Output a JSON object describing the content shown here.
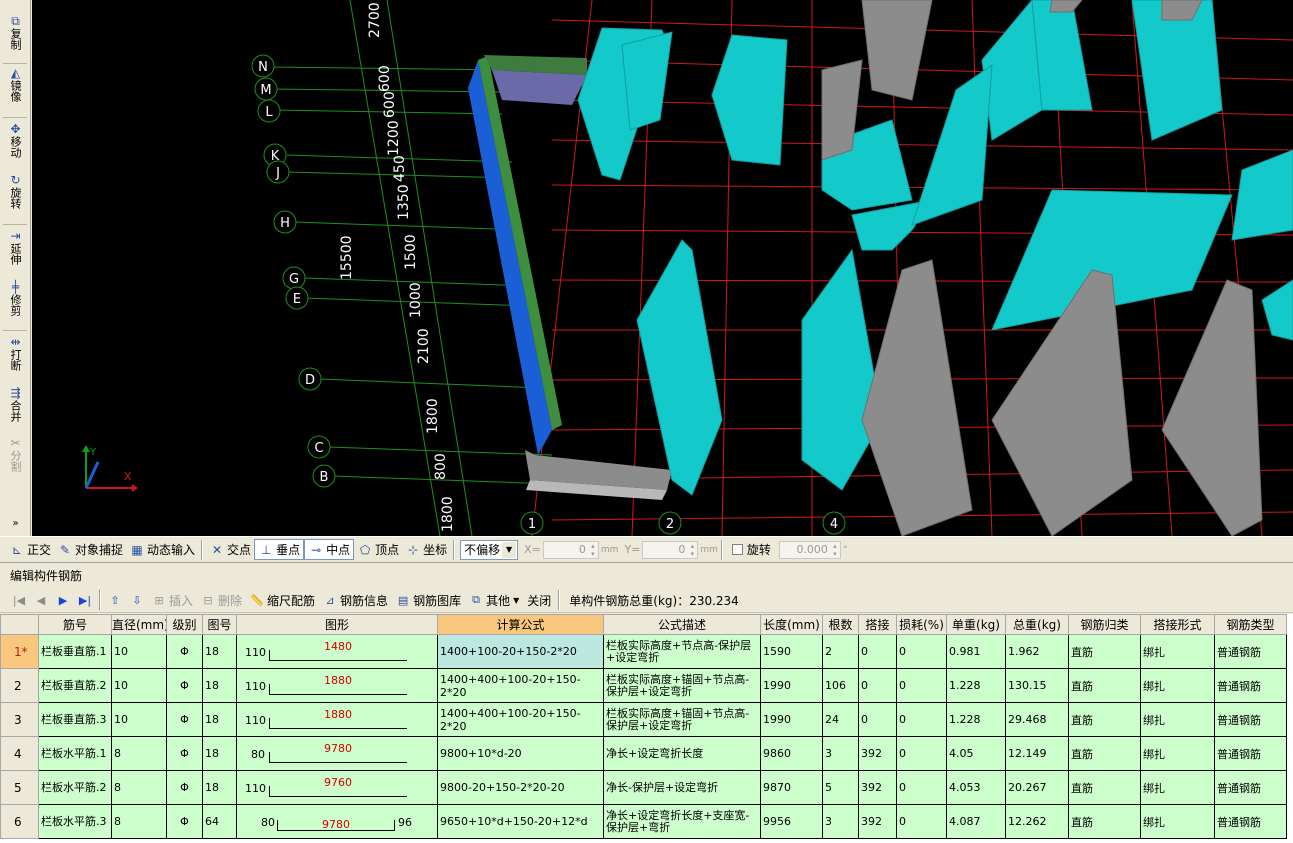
{
  "left_toolbar": {
    "tools": [
      {
        "label": "复制",
        "icon": "copy-icon",
        "glyph": "⧉",
        "disabled": false
      },
      {
        "label": "镜像",
        "icon": "mirror-icon",
        "glyph": "◭",
        "disabled": false
      },
      {
        "label": "移动",
        "icon": "move-icon",
        "glyph": "✥",
        "disabled": false
      },
      {
        "label": "旋转",
        "icon": "rotate-icon",
        "glyph": "↻",
        "disabled": false
      },
      {
        "label": "延伸",
        "icon": "extend-icon",
        "glyph": "⇥",
        "disabled": false
      },
      {
        "label": "修剪",
        "icon": "trim-icon",
        "glyph": "╪",
        "disabled": false
      },
      {
        "label": "打断",
        "icon": "break-icon",
        "glyph": "⇹",
        "disabled": false
      },
      {
        "label": "合并",
        "icon": "merge-icon",
        "glyph": "⇶",
        "disabled": false
      },
      {
        "label": "分割",
        "icon": "split-icon",
        "glyph": "✂",
        "disabled": true
      }
    ]
  },
  "canvas": {
    "axis_labels": [
      "N",
      "M",
      "L",
      "K",
      "J",
      "H",
      "G",
      "E",
      "D",
      "C",
      "B"
    ],
    "dimension_labels": [
      "2700",
      "600",
      "600",
      "1200",
      "450",
      "1350",
      "1500",
      "15500",
      "1000",
      "2100",
      "1800",
      "800",
      "1800"
    ],
    "bottom_axis_labels": [
      "1",
      "2",
      "4"
    ],
    "ucs": {
      "x": "X",
      "y": "Y"
    }
  },
  "snap_bar": {
    "ortho": "正交",
    "object_snap": "对象捕捉",
    "dynamic_input": "动态输入",
    "intersection": "交点",
    "perpendicular": "垂点",
    "midpoint": "中点",
    "vertex": "顶点",
    "coordinate": "坐标",
    "offset_mode": "不偏移",
    "x_label": "X=",
    "x_value": "0",
    "y_label": "Y=",
    "y_value": "0",
    "unit": "mm",
    "rotate_label": "旋转",
    "rotate_value": "0.000",
    "degree": "°"
  },
  "editor": {
    "title": "编辑构件钢筋",
    "toolbar": {
      "insert": "插入",
      "delete": "删除",
      "scale_rebar": "缩尺配筋",
      "rebar_info": "钢筋信息",
      "rebar_library": "钢筋图库",
      "other": "其他",
      "close": "关闭",
      "total_weight_label": "单构件钢筋总重(kg)：230.234"
    }
  },
  "table": {
    "columns": [
      "",
      "筋号",
      "直径(mm)",
      "级别",
      "图号",
      "图形",
      "计算公式",
      "公式描述",
      "长度(mm)",
      "根数",
      "搭接",
      "损耗(%)",
      "单重(kg)",
      "总重(kg)",
      "钢筋归类",
      "搭接形式",
      "钢筋类型"
    ],
    "rows": [
      {
        "num": "1*",
        "name": "栏板垂直筋.1",
        "dia": "10",
        "grade": "Φ",
        "fig": "18",
        "shape_lead": "110",
        "shape_len": "1480",
        "shape_tail": "",
        "formula": "1400+100-20+150-2*20",
        "desc": "栏板实际高度+节点高-保护层+设定弯折",
        "length": "1590",
        "count": "2",
        "lap": "0",
        "loss": "0",
        "unit_w": "0.981",
        "total_w": "1.962",
        "category": "直筋",
        "lap_type": "绑扎",
        "type": "普通钢筋"
      },
      {
        "num": "2",
        "name": "栏板垂直筋.2",
        "dia": "10",
        "grade": "Φ",
        "fig": "18",
        "shape_lead": "110",
        "shape_len": "1880",
        "shape_tail": "",
        "formula": "1400+400+100-20+150-2*20",
        "desc": "栏板实际高度+锚固+节点高-保护层+设定弯折",
        "length": "1990",
        "count": "106",
        "lap": "0",
        "loss": "0",
        "unit_w": "1.228",
        "total_w": "130.15",
        "category": "直筋",
        "lap_type": "绑扎",
        "type": "普通钢筋"
      },
      {
        "num": "3",
        "name": "栏板垂直筋.3",
        "dia": "10",
        "grade": "Φ",
        "fig": "18",
        "shape_lead": "110",
        "shape_len": "1880",
        "shape_tail": "",
        "formula": "1400+400+100-20+150-2*20",
        "desc": "栏板实际高度+锚固+节点高-保护层+设定弯折",
        "length": "1990",
        "count": "24",
        "lap": "0",
        "loss": "0",
        "unit_w": "1.228",
        "total_w": "29.468",
        "category": "直筋",
        "lap_type": "绑扎",
        "type": "普通钢筋"
      },
      {
        "num": "4",
        "name": "栏板水平筋.1",
        "dia": "8",
        "grade": "Φ",
        "fig": "18",
        "shape_lead": "80",
        "shape_len": "9780",
        "shape_tail": "",
        "formula": "9800+10*d-20",
        "desc": "净长+设定弯折长度",
        "length": "9860",
        "count": "3",
        "lap": "392",
        "loss": "0",
        "unit_w": "4.05",
        "total_w": "12.149",
        "category": "直筋",
        "lap_type": "绑扎",
        "type": "普通钢筋"
      },
      {
        "num": "5",
        "name": "栏板水平筋.2",
        "dia": "8",
        "grade": "Φ",
        "fig": "18",
        "shape_lead": "110",
        "shape_len": "9760",
        "shape_tail": "",
        "formula": "9800-20+150-2*20-20",
        "desc": "净长-保护层+设定弯折",
        "length": "9870",
        "count": "5",
        "lap": "392",
        "loss": "0",
        "unit_w": "4.053",
        "total_w": "20.267",
        "category": "直筋",
        "lap_type": "绑扎",
        "type": "普通钢筋"
      },
      {
        "num": "6",
        "name": "栏板水平筋.3",
        "dia": "8",
        "grade": "Φ",
        "fig": "64",
        "shape_lead": "80",
        "shape_len": "9780",
        "shape_tail": "96",
        "formula": "9650+10*d+150-20+12*d",
        "desc": "净长+设定弯折长度+支座宽-保护层+弯折",
        "length": "9956",
        "count": "3",
        "lap": "392",
        "loss": "0",
        "unit_w": "4.087",
        "total_w": "12.262",
        "category": "直筋",
        "lap_type": "绑扎",
        "type": "普通钢筋"
      }
    ]
  },
  "colors": {
    "grid_green": "#1f8f1f",
    "grid_red": "#d01818",
    "wall_cyan": "#13c9c9",
    "wall_gray": "#8c8c8c",
    "rail_blue": "#1a5fd6",
    "row_green": "#ccffcc",
    "header_highlight": "#f9c77d"
  }
}
